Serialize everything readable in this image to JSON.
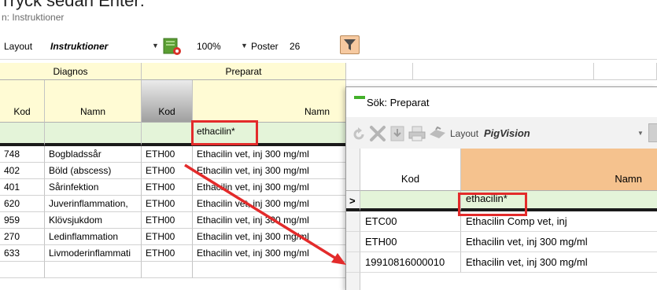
{
  "page": {
    "title_fragment": "Tryck sedan Enter:",
    "subtitle": "n: Instruktioner"
  },
  "toolbar": {
    "layout_label": "Layout",
    "layout_value": "Instruktioner",
    "zoom_value": "100%",
    "poster_label": "Poster",
    "poster_value": "26"
  },
  "grid": {
    "group_headers": [
      "Diagnos",
      "Preparat"
    ],
    "columns": [
      "Kod",
      "Namn",
      "Kod",
      "Namn"
    ],
    "filter_value": "ethacilin*",
    "rows": [
      [
        "748",
        "Bogbladssår",
        "ETH00",
        "Ethacilin vet, inj 300 mg/ml"
      ],
      [
        "402",
        "Böld (abscess)",
        "ETH00",
        "Ethacilin vet, inj 300 mg/ml"
      ],
      [
        "401",
        "Sårinfektion",
        "ETH00",
        "Ethacilin vet, inj 300 mg/ml"
      ],
      [
        "620",
        "Juverinflammation,",
        "ETH00",
        "Ethacilin vet, inj 300 mg/ml"
      ],
      [
        "959",
        "Klövsjukdom",
        "ETH00",
        "Ethacilin vet, inj 300 mg/ml"
      ],
      [
        "270",
        "Ledinflammation",
        "ETH00",
        "Ethacilin vet, inj 300 mg/ml"
      ],
      [
        "633",
        "Livmoderinflammati",
        "ETH00",
        "Ethacilin vet, inj 300 mg/ml"
      ]
    ]
  },
  "dialog": {
    "title": "Sök: Preparat",
    "layout_label": "Layout",
    "layout_value": "PigVision",
    "columns": [
      "Kod",
      "Namn"
    ],
    "row_indicator": ">",
    "filter_value": "ethacilin*",
    "rows": [
      [
        "ETC00",
        "Ethacilin Comp vet, inj"
      ],
      [
        "ETH00",
        "Ethacilin vet, inj 300 mg/ml"
      ],
      [
        "19910816000010",
        "Ethacilin vet, inj 300 mg/ml"
      ]
    ]
  },
  "colors": {
    "header_bg": "#fffbd4",
    "filter_row_bg": "#e4f4d9",
    "dialog_header_bg": "#f5c28e",
    "highlight": "#e32b2b",
    "filter_button_bg": "#f6c9a0"
  }
}
